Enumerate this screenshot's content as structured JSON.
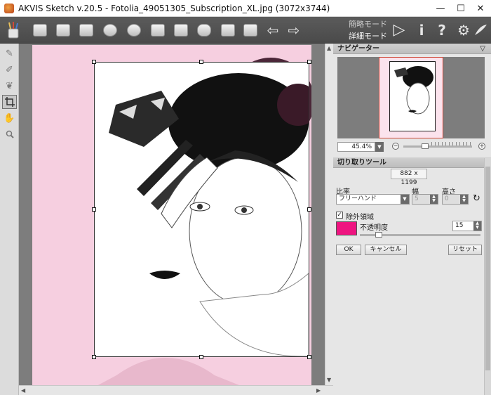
{
  "window": {
    "title": "AKVIS Sketch v.20.5 - Fotolia_49051305_Subscription_XL.jpg (3072x3744)",
    "minimize_glyph": "—",
    "maximize_glyph": "☐",
    "close_glyph": "✕"
  },
  "toolbar": {
    "mode_simple": "簡略モード",
    "mode_detailed": "詳細モード",
    "run_glyph": "▷",
    "info_glyph": "i",
    "help_glyph": "?",
    "settings_glyph": "⚙",
    "undo_glyph": "⇦",
    "redo_glyph": "⇨"
  },
  "canvas": {
    "photo_bg_color": "#f6cfe0",
    "hscroll_left": "◀",
    "hscroll_right": "▶",
    "vscroll_up": "▲",
    "vscroll_down": "▼"
  },
  "navigator": {
    "title": "ナビゲーター",
    "collapse_glyph": "▽",
    "zoom_value": "45.4%",
    "zoom_out_glyph": "−",
    "zoom_in_glyph": "+"
  },
  "crop_tool": {
    "title": "切り取りツール",
    "size": "882 x 1199",
    "ratio_label": "比率",
    "ratio_value": "フリーハンド",
    "width_label": "幅",
    "width_value": "5",
    "height_label": "高さ",
    "height_value": "0",
    "swap_glyph": "↻",
    "exclude_label": "除外領域",
    "exclude_checked_glyph": "✓",
    "exclude_color": "#ee1480",
    "opacity_label": "不透明度",
    "opacity_value": "15",
    "ok_label": "OK",
    "cancel_label": "キャンセル",
    "reset_label": "リセット"
  }
}
